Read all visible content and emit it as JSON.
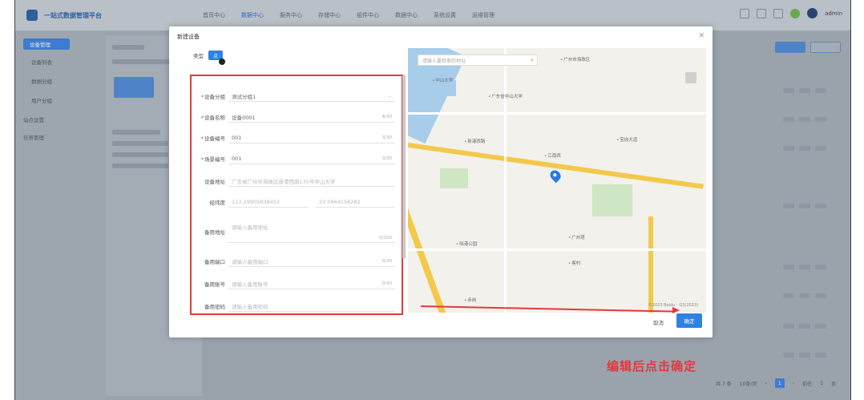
{
  "app": {
    "title": "一站式数据管理平台"
  },
  "nav": [
    "首页中心",
    "数据中心",
    "服务中心",
    "存储中心",
    "组件中心",
    "数据中心",
    "系统设置",
    "运维管理"
  ],
  "nav_active_index": 1,
  "topbar": {
    "user": "admin"
  },
  "sidebar": {
    "items": [
      "设备管理",
      "设备列表",
      "数据分组",
      "用户分组",
      "站点设置",
      "任务管理"
    ],
    "active_index": 0
  },
  "modal": {
    "title": "新建设备",
    "type_label": "类型",
    "type_value": "点",
    "fields": [
      {
        "label": "设备分组",
        "value": "测试分组1",
        "required": true,
        "count": ""
      },
      {
        "label": "设备名称",
        "value": "设备0001",
        "required": true,
        "count": "4/30"
      },
      {
        "label": "设备编号",
        "value": "001",
        "required": true,
        "count": "3/30"
      },
      {
        "label": "场景编号",
        "value": "001",
        "required": true,
        "count": "3/30"
      },
      {
        "label": "设备地址",
        "value": "广东省广州市海珠区新港西路135号中山大学",
        "required": false,
        "count": ""
      },
      {
        "label": "经纬度",
        "value": "113.2990,23.0964",
        "required": false,
        "count": ""
      },
      {
        "label": "备用地址",
        "value": "请输入备用地址",
        "required": false,
        "count": "0/100"
      },
      {
        "label": "备用端口",
        "value": "请输入备用端口",
        "required": false,
        "count": "0/30"
      },
      {
        "label": "备用账号",
        "value": "请输入备用账号",
        "required": false,
        "count": "0/30"
      },
      {
        "label": "备用密码",
        "value": "请输入备用密码",
        "required": false,
        "count": ""
      }
    ],
    "lnglat": [
      "113.29905838452",
      "23.0964156282"
    ],
    "cancel_label": "取消",
    "ok_label": "确定"
  },
  "map": {
    "search_placeholder": "请输入要检索的地址",
    "pois": [
      "广州市海珠区",
      "中山大学",
      "广东省中山大学",
      "新港西路",
      "江南西",
      "宝岗大道",
      "晓港公园",
      "广州塔",
      "客村",
      "赤岗"
    ],
    "copyright": "©2023 Baidu - GS(2023)"
  },
  "annotation": "编辑后点击确定",
  "pager": {
    "total": "共 7 条",
    "size": "10条/页",
    "current": "1",
    "goto": "前往",
    "page": "1",
    "suffix": "页"
  },
  "colors": {
    "accent": "#2f82e0",
    "highlight": "#e23b3b"
  }
}
